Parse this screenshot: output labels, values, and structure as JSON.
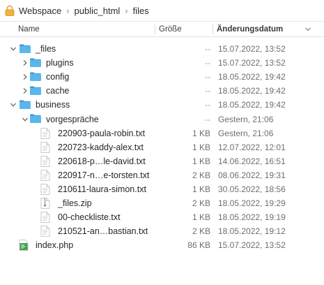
{
  "path": {
    "segments": [
      "Webspace",
      "public_html",
      "files"
    ],
    "separator": "›"
  },
  "columns": {
    "name": "Name",
    "size": "Größe",
    "date": "Änderungsdatum"
  },
  "colors": {
    "folder": "#5ab7e9",
    "folder_tab": "#3e9ed6",
    "text_primary": "#262626",
    "text_secondary": "#6e6e6e"
  },
  "rows": [
    {
      "name": "_files",
      "size": "--",
      "date": "15.07.2022, 13:52",
      "kind": "folder",
      "depth": 0,
      "expanded": true
    },
    {
      "name": "plugins",
      "size": "--",
      "date": "15.07.2022, 13:52",
      "kind": "folder",
      "depth": 1,
      "expanded": false
    },
    {
      "name": "config",
      "size": "--",
      "date": "18.05.2022, 19:42",
      "kind": "folder",
      "depth": 1,
      "expanded": false
    },
    {
      "name": "cache",
      "size": "--",
      "date": "18.05.2022, 19:42",
      "kind": "folder",
      "depth": 1,
      "expanded": false
    },
    {
      "name": "business",
      "size": "--",
      "date": "18.05.2022, 19:42",
      "kind": "folder",
      "depth": 0,
      "expanded": true
    },
    {
      "name": "vorgespräche",
      "size": "--",
      "date": "Gestern, 21:06",
      "kind": "folder",
      "depth": 1,
      "expanded": true
    },
    {
      "name": "220903-paula-robin.txt",
      "size": "1 KB",
      "date": "Gestern, 21:06",
      "kind": "txt",
      "depth": 2
    },
    {
      "name": "220723-kaddy-alex.txt",
      "size": "1 KB",
      "date": "12.07.2022, 12:01",
      "kind": "txt",
      "depth": 2
    },
    {
      "name": "220618-p…le-david.txt",
      "size": "1 KB",
      "date": "14.06.2022, 16:51",
      "kind": "txt",
      "depth": 2
    },
    {
      "name": "220917-n…e-torsten.txt",
      "size": "2 KB",
      "date": "08.06.2022, 19:31",
      "kind": "txt",
      "depth": 2
    },
    {
      "name": "210611-laura-simon.txt",
      "size": "1 KB",
      "date": "30.05.2022, 18:56",
      "kind": "txt",
      "depth": 2
    },
    {
      "name": "_files.zip",
      "size": "2 KB",
      "date": "18.05.2022, 19:29",
      "kind": "zip",
      "depth": 2
    },
    {
      "name": "00-checkliste.txt",
      "size": "1 KB",
      "date": "18.05.2022, 19:19",
      "kind": "txt",
      "depth": 2
    },
    {
      "name": "210521-an…bastian.txt",
      "size": "2 KB",
      "date": "18.05.2022, 19:12",
      "kind": "txt",
      "depth": 2
    },
    {
      "name": "index.php",
      "size": "86 KB",
      "date": "15.07.2022, 13:52",
      "kind": "php",
      "depth": 0
    }
  ]
}
